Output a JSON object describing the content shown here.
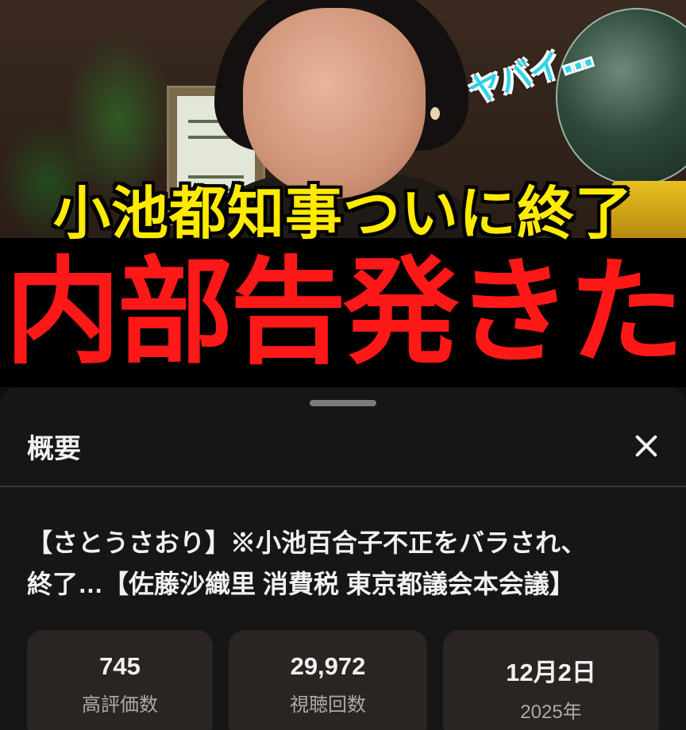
{
  "thumbnail": {
    "headline_top": "小池都知事ついに終了",
    "headline_main": "内部告発きた",
    "exclaim": "ヤバイ…",
    "colors": {
      "headline_top": "#ffeb00",
      "headline_main": "#ff1818",
      "exclaim": "#2fd4e8"
    }
  },
  "sheet": {
    "title": "概要",
    "close_icon": "close-icon",
    "video_title_line1": "【さとうさおり】※小池百合子不正をバラされ、",
    "video_title_line2": "終了…【佐藤沙織里 消費税 東京都議会本会議】",
    "stats": [
      {
        "value": "745",
        "label": "高評価数"
      },
      {
        "value": "29,972",
        "label": "視聴回数"
      },
      {
        "value": "12月2日",
        "label": "2025年"
      }
    ]
  }
}
